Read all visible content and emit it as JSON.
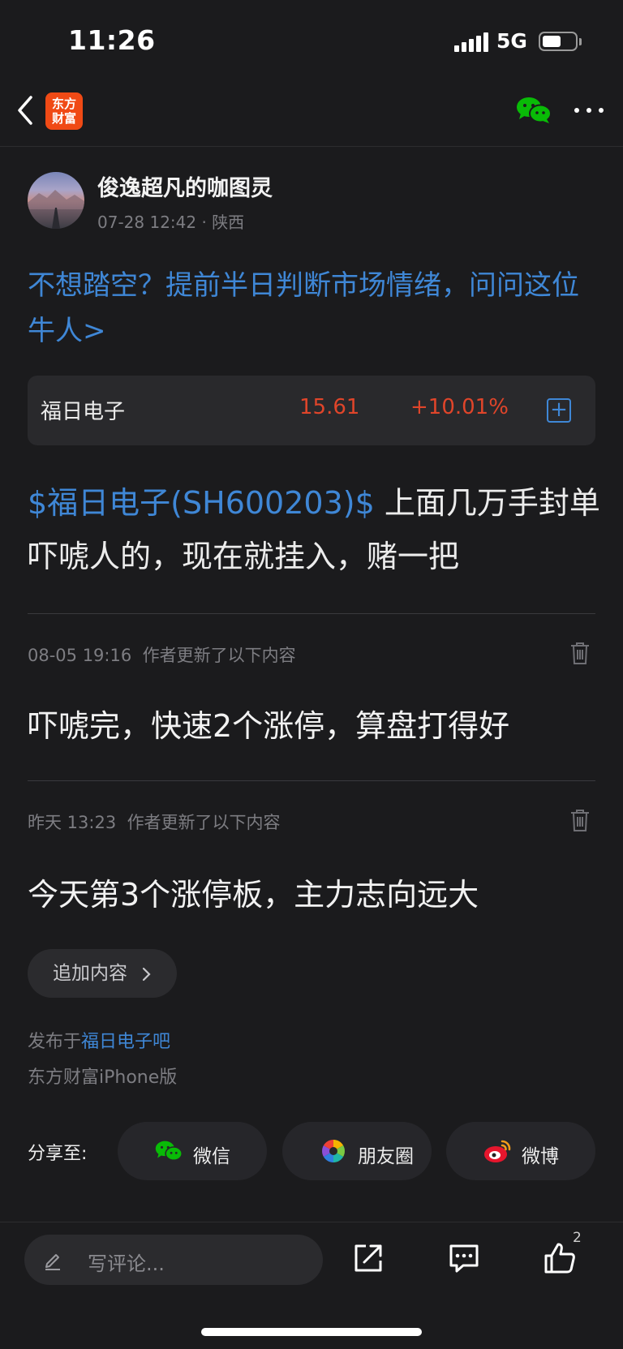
{
  "status_bar": {
    "time": "11:26",
    "network": "5G"
  },
  "nav": {
    "logo_line1": "东方",
    "logo_line2": "财富"
  },
  "post": {
    "author": "俊逸超凡的咖图灵",
    "date": "07-28 12:42",
    "location": "陕西",
    "promo_text": "不想踏空？提前半日判断市场情绪，问问这位牛人>",
    "stock": {
      "name": "福日电子",
      "price": "15.61",
      "change": "+10.01%",
      "add_symbol": "+"
    },
    "tag": "$福日电子(SH600203)$",
    "body": "上面几万手封单吓唬人的，现在就挂入，赌一把"
  },
  "updates": [
    {
      "time": "08-05 19:16",
      "label": "作者更新了以下内容",
      "text": "吓唬完，快速2个涨停，算盘打得好"
    },
    {
      "time": "昨天 13:23",
      "label": "作者更新了以下内容",
      "text": "今天第3个涨停板，主力志向远大"
    }
  ],
  "append_button": "追加内容",
  "published": {
    "prefix": "发布于",
    "forum": "福日电子吧",
    "client": "东方财富iPhone版"
  },
  "share": {
    "label": "分享至:",
    "wechat": "微信",
    "moments": "朋友圈",
    "weibo": "微博"
  },
  "bottom_bar": {
    "comment_placeholder": "写评论...",
    "like_count": "2"
  },
  "colors": {
    "background": "#1b1b1d",
    "accent_blue": "#3f87d6",
    "rise_red": "#e0452a",
    "logo_orange": "#f04a15",
    "wechat_green": "#09bb07"
  },
  "icons": [
    "back-icon",
    "wechat-icon",
    "more-icon",
    "add-icon",
    "trash-icon",
    "chevron-right-icon",
    "moments-icon",
    "weibo-icon",
    "pencil-icon",
    "share-icon",
    "comment-icon",
    "like-icon"
  ]
}
